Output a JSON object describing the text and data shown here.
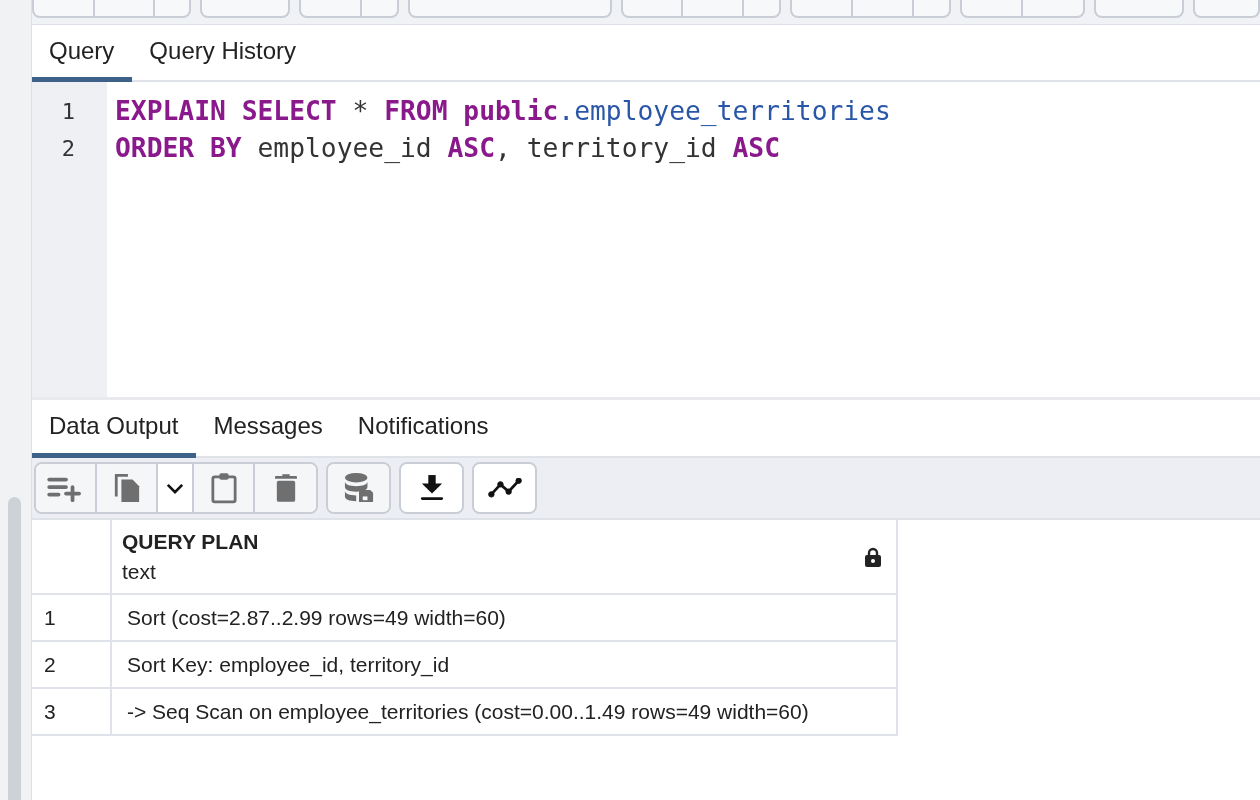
{
  "query_tabs": [
    {
      "label": "Query",
      "selected": true
    },
    {
      "label": "Query History",
      "selected": false
    }
  ],
  "editor": {
    "lines": [
      {
        "number": "1",
        "tokens": [
          {
            "kind": "keyword",
            "text": "EXPLAIN SELECT"
          },
          {
            "kind": "plain",
            "text": " * "
          },
          {
            "kind": "keyword",
            "text": "FROM public"
          },
          {
            "kind": "name",
            "text": ".employee_territories"
          }
        ]
      },
      {
        "number": "2",
        "tokens": [
          {
            "kind": "keyword",
            "text": "ORDER BY"
          },
          {
            "kind": "plain",
            "text": " employee_id "
          },
          {
            "kind": "keyword",
            "text": "ASC"
          },
          {
            "kind": "plain",
            "text": ", territory_id "
          },
          {
            "kind": "keyword",
            "text": "ASC"
          }
        ]
      }
    ]
  },
  "result_tabs": [
    {
      "label": "Data Output",
      "selected": true
    },
    {
      "label": "Messages",
      "selected": false
    },
    {
      "label": "Notifications",
      "selected": false
    }
  ],
  "result_toolbar": [
    {
      "group": [
        {
          "kind": "add-row",
          "disabled": true
        },
        {
          "kind": "copy",
          "disabled": true
        },
        {
          "kind": "caret",
          "disabled": false
        },
        {
          "kind": "paste",
          "disabled": true
        },
        {
          "kind": "delete",
          "disabled": true
        }
      ]
    },
    {
      "group": [
        {
          "kind": "save-data",
          "disabled": true
        }
      ]
    },
    {
      "group": [
        {
          "kind": "download",
          "disabled": false
        }
      ]
    },
    {
      "group": [
        {
          "kind": "graph",
          "disabled": false
        }
      ]
    }
  ],
  "table": {
    "columns": [
      {
        "name": "QUERY PLAN",
        "type": "text",
        "locked": true
      }
    ],
    "rows": [
      {
        "number": "1",
        "cells": [
          "Sort (cost=2.87..2.99 rows=49 width=60)"
        ]
      },
      {
        "number": "2",
        "cells": [
          "Sort Key: employee_id, territory_id"
        ]
      },
      {
        "number": "3",
        "cells": [
          "-> Seq Scan on employee_territories (cost=0.00..1.49 rows=49 width=60)"
        ]
      }
    ]
  }
}
